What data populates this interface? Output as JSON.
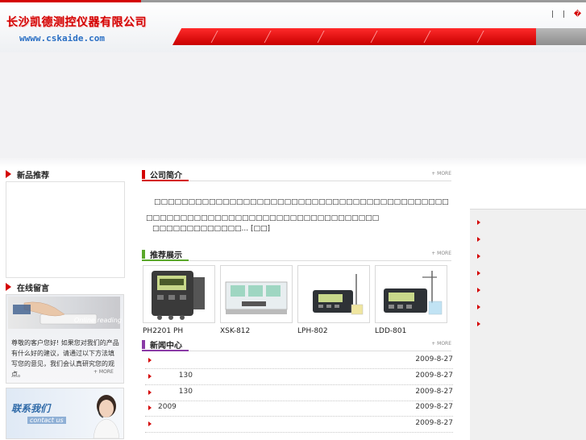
{
  "header": {
    "company_name": "长沙凯德测控仪器有限公司",
    "website": "wwww.cskaide.com",
    "top_links": [
      "|",
      "|",
      "�"
    ]
  },
  "sections": {
    "new_products": "新品推荐",
    "company_intro": "公司简介",
    "recommended": "推荐展示",
    "news_center": "新闻中心",
    "online_message": "在线留言",
    "more_label": "+ MORE"
  },
  "intro": {
    "paragraph": "□□□□□□□□□□□□□□□□□□□□□□□□□□□□□□□□□□□□□□□□□□□□□□□□□□□□□□□□□□□□□□□□□□□□□□□□□□□□□",
    "second_line": "□□□□□□□□□□□□□... [□□]"
  },
  "products": [
    {
      "name": "PH2201  PH"
    },
    {
      "name": "XSK-812"
    },
    {
      "name": "LPH-802"
    },
    {
      "name": "LDD-801"
    }
  ],
  "news": [
    {
      "title": "",
      "date": "2009-8-27"
    },
    {
      "title": "         130",
      "date": "2009-8-27"
    },
    {
      "title": "         130",
      "date": "2009-8-27"
    },
    {
      "title": "2009",
      "date": "2009-8-27"
    },
    {
      "title": "",
      "date": "2009-8-27"
    }
  ],
  "message_panel": {
    "image_caption": "Online reading",
    "text": "尊敬的客户您好! 如果您对我们的产品有什么好的建议，请通过以下方法填写您的意见，我们会认真研究您的观点。",
    "more": "+ MORE"
  },
  "contact_panel": {
    "title_cn": "联系我们",
    "title_en": "contact us"
  },
  "colors": {
    "brand_red": "#d40000",
    "intro_accent": "#d40000",
    "recommend_accent": "#5aa82a",
    "news_accent": "#8a3aa6"
  }
}
